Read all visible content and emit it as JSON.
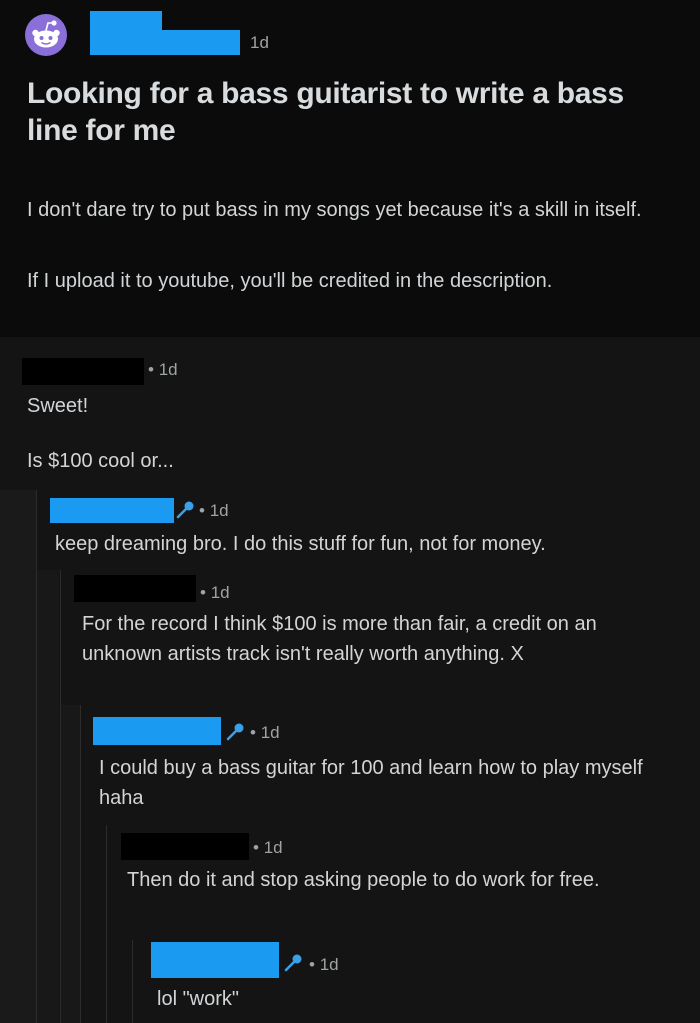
{
  "post": {
    "time": "1d",
    "title": "Looking for a bass guitarist to write a bass line for me",
    "body": [
      "I don't dare try to put bass in my songs yet because it's a skill in itself.",
      "If I upload it to youtube, you'll be credited in the description."
    ],
    "subreddit_icon": "reddit-alien-icon"
  },
  "comments": [
    {
      "time": "1d",
      "lines": [
        "Sweet!",
        "Is $100 cool or..."
      ]
    },
    {
      "time": "1d",
      "is_op": true,
      "text": "keep dreaming bro. I do this stuff for fun, not for money."
    },
    {
      "time": "1d",
      "text": "For the record I think $100 is more than fair, a credit on an unknown artists track isn't really worth anything. X"
    },
    {
      "time": "1d",
      "is_op": true,
      "text": "I could buy a bass guitar for 100 and learn how to play myself haha"
    },
    {
      "time": "1d",
      "text": "Then do it and stop asking people to do work for free."
    },
    {
      "time": "1d",
      "is_op": true,
      "text": "lol \"work\""
    }
  ],
  "colors": {
    "redaction_blue": "#1a9af0",
    "op_mic_blue": "#3aa0e8",
    "subreddit_purple": "#8b6fd9"
  },
  "icons": {
    "op_badge": "microphone-icon"
  }
}
